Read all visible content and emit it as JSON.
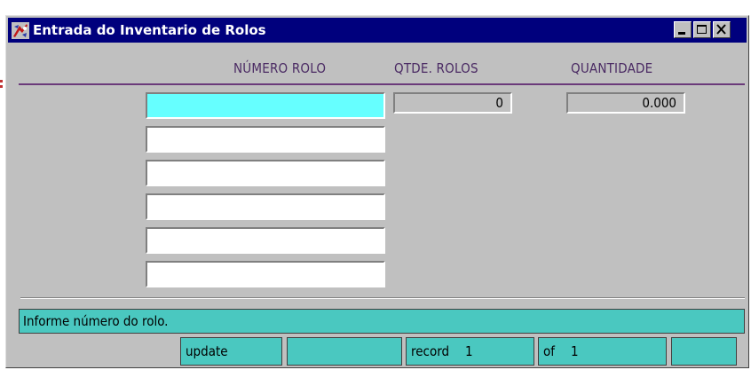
{
  "window": {
    "title": "Entrada do Inventario de Rolos"
  },
  "headers": {
    "numero_rolo": "NÚMERO ROLO",
    "qtde_rolos": "QTDE. ROLOS",
    "quantidade": "QUANTIDADE"
  },
  "fields": {
    "numero_rolo_values": [
      "",
      "",
      "",
      "",
      "",
      ""
    ],
    "qtde_rolos": "0",
    "quantidade": "0.000"
  },
  "message": "Informe número do rolo.",
  "status": {
    "mode": "update",
    "blank1": "",
    "record_label": "record",
    "record_num": "1",
    "of_label": "of",
    "of_num": "1",
    "blank2": ""
  },
  "colors": {
    "titlebar": "#00007d",
    "active_field": "#66ffff",
    "status_bg": "#4ac8c0",
    "header_text": "#4a2a63",
    "rule": "#6b3a7a"
  }
}
